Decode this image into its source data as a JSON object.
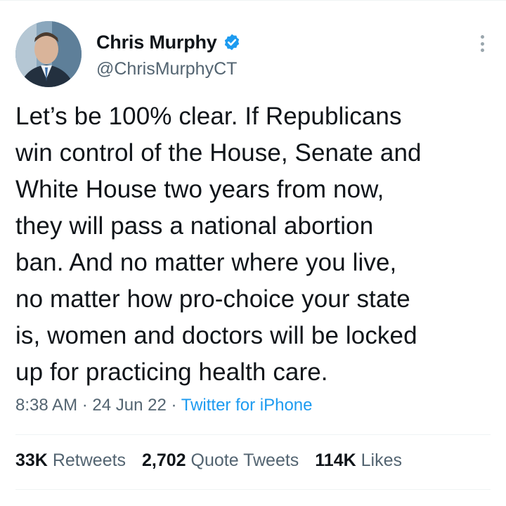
{
  "author": {
    "display_name": "Chris Murphy",
    "handle": "@ChrisMurphyCT",
    "verified_icon": "verified-badge-icon"
  },
  "tweet": {
    "lines": [
      "Let’s be 100% clear. If Republicans",
      "win control of the House, Senate and",
      "White House two years from now,",
      "they will pass a national abortion",
      "ban. And no matter where you live,",
      "no matter how pro-choice your state",
      "is, women and doctors will be locked",
      "up for practicing health care."
    ],
    "time": "8:38 AM",
    "date": "24 Jun 22",
    "separator": "·",
    "source": "Twitter for iPhone"
  },
  "stats": {
    "retweets_count": "33K",
    "retweets_label": "Retweets",
    "quotes_count": "2,702",
    "quotes_label": "Quote Tweets",
    "likes_count": "114K",
    "likes_label": "Likes"
  },
  "colors": {
    "text": "#0f1419",
    "secondary": "#536471",
    "link": "#1d9bf0",
    "divider": "#eff3f4"
  }
}
